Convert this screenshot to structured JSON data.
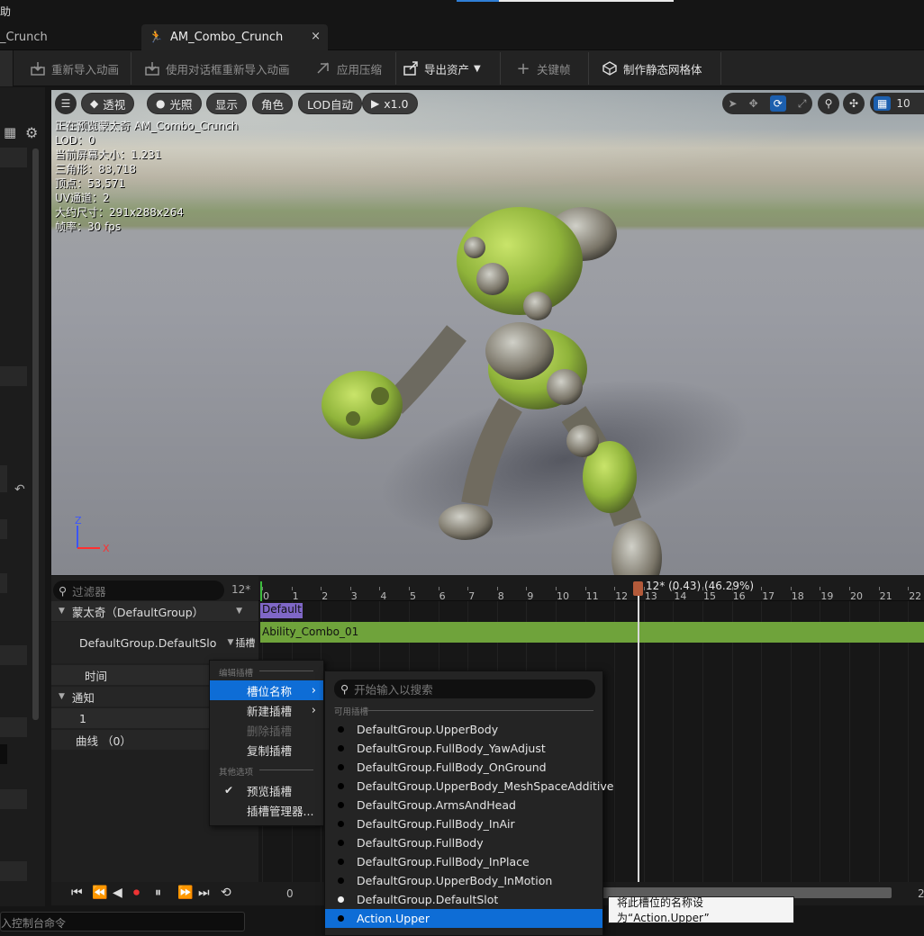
{
  "menubar": {
    "fragment": "助"
  },
  "tabs": [
    {
      "label": "_Crunch"
    },
    {
      "label": "AM_Combo_Crunch",
      "close": "×"
    }
  ],
  "toolbar": {
    "reimport": "重新导入动画",
    "reimport_dialog": "使用对话框重新导入动画",
    "apply_compression": "应用压缩",
    "export_asset": "导出资产",
    "keyframe": "关键帧",
    "make_static_mesh": "制作静态网格体"
  },
  "viewport": {
    "buttons": {
      "perspective": "透视",
      "lighting": "光照",
      "show": "显示",
      "character": "角色",
      "lod": "LOD自动",
      "speed": "x1.0",
      "grid_size": "10"
    },
    "stats": [
      "正在预览蒙太奇 AM_Combo_Crunch",
      "LOD：0",
      "当前屏幕大小：1.231",
      "三角形：83,718",
      "顶点：53,571",
      "UV通道：2",
      "大约尺寸：291x288x264",
      "帧率：30 fps"
    ],
    "axis": {
      "z": "Z",
      "x": "X"
    }
  },
  "animation_panel": {
    "filter_placeholder": "过滤器",
    "frame": "12*",
    "montage_group": "蒙太奇（DefaultGroup）",
    "slot_name": "DefaultGroup.DefaultSlo",
    "slot_button": "插槽",
    "time": "时间",
    "notifies": "通知",
    "notify_track": "1",
    "curves": "曲线 （0）"
  },
  "timeline": {
    "playhead_label": "12* (0.43) (46.29%)",
    "ticks": [
      "0",
      "1",
      "2",
      "3",
      "4",
      "5",
      "6",
      "7",
      "8",
      "9",
      "10",
      "11",
      "12",
      "13",
      "14",
      "15",
      "16",
      "17",
      "18",
      "19",
      "20",
      "21",
      "22"
    ],
    "section_default": "Default",
    "segment_name": "Ability_Combo_01",
    "bottom_start": "0",
    "bottom_end": "2"
  },
  "context_menu": {
    "header_edit": "编辑插槽",
    "slot_name": "槽位名称",
    "new_slot": "新建插槽",
    "delete_slot": "删除插槽",
    "duplicate_slot": "复制插槽",
    "header_other": "其他选项",
    "preview_slot": "预览插槽",
    "slot_manager": "插槽管理器..."
  },
  "submenu": {
    "search_placeholder": "开始输入以搜索",
    "header": "可用插槽",
    "items": [
      "DefaultGroup.UpperBody",
      "DefaultGroup.FullBody_YawAdjust",
      "DefaultGroup.FullBody_OnGround",
      "DefaultGroup.UpperBody_MeshSpaceAdditive",
      "DefaultGroup.ArmsAndHead",
      "DefaultGroup.FullBody_InAir",
      "DefaultGroup.FullBody",
      "DefaultGroup.FullBody_InPlace",
      "DefaultGroup.UpperBody_InMotion",
      "DefaultGroup.DefaultSlot",
      "Action.Upper"
    ]
  },
  "tooltip": "将此槽位的名称设为“Action.Upper”",
  "console": {
    "placeholder": "入控制台命令"
  },
  "colors": {
    "accent": "#0e6dd6",
    "montage_section": "#7f67c6",
    "segment": "#6fa33b",
    "playhead": "#b35a3a"
  }
}
